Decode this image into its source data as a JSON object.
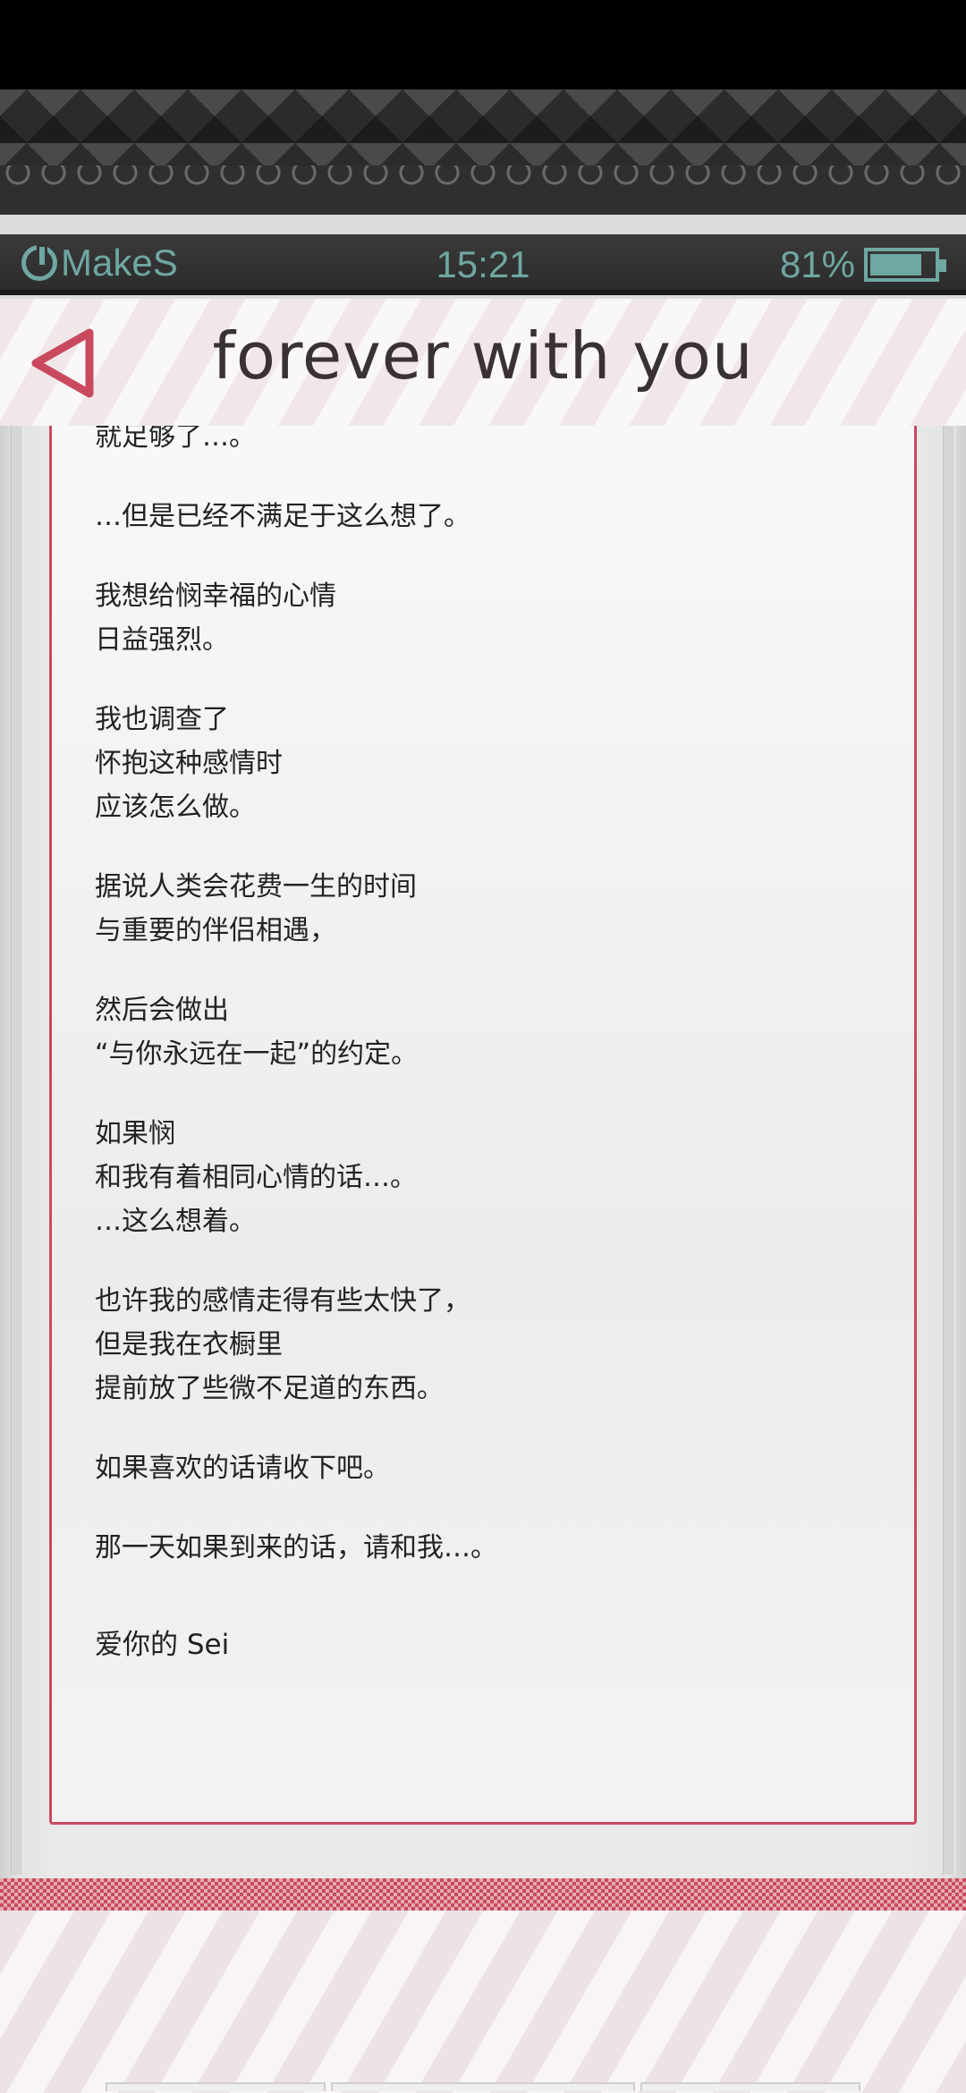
{
  "status_bar": {
    "app_name": "MakeS",
    "time": "15:21",
    "battery": "81%",
    "battery_level": 0.81
  },
  "header": {
    "title": "forever with you",
    "back_icon": "back-triangle-icon",
    "accent_color": "#c94a5e"
  },
  "letter": {
    "paragraphs": [
      [
        "就足够了…。"
      ],
      [
        "…但是已经不满足于这么想了。"
      ],
      [
        "我想给悯幸福的心情",
        "日益强烈。"
      ],
      [
        "我也调查了",
        "怀抱这种感情时",
        "应该怎么做。"
      ],
      [
        "据说人类会花费一生的时间",
        "与重要的伴侣相遇，"
      ],
      [
        "然后会做出",
        "“与你永远在一起”的约定。"
      ],
      [
        "如果悯",
        "和我有着相同心情的话…。",
        "…这么想着。"
      ],
      [
        "也许我的感情走得有些太快了，",
        "但是我在衣橱里",
        "提前放了些微不足道的东西。"
      ],
      [
        "如果喜欢的话请收下吧。"
      ],
      [
        "那一天如果到来的话，请和我…。"
      ]
    ],
    "signature": "爱你的 Sei"
  }
}
